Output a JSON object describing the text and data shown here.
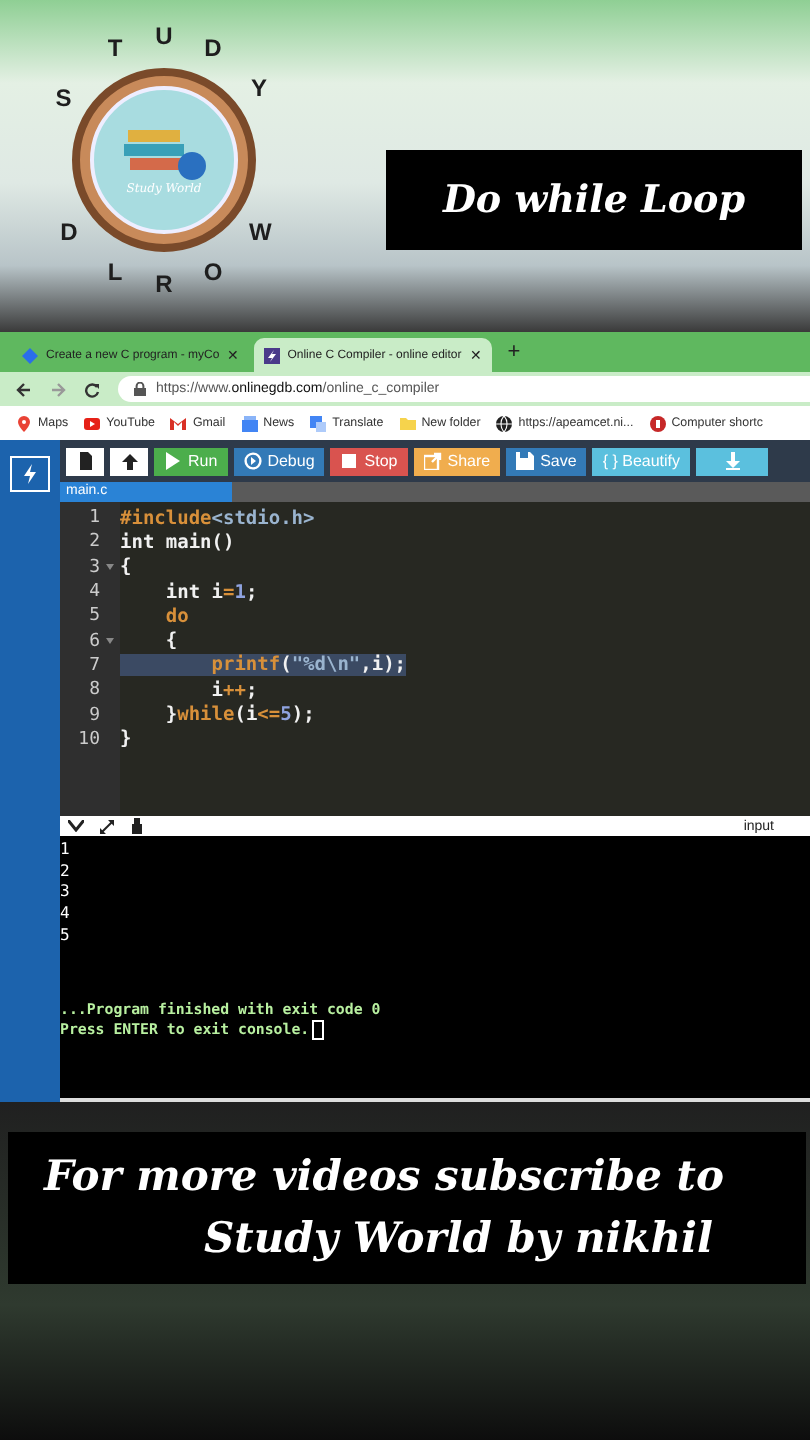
{
  "logo": {
    "ring_letters": [
      "S",
      "T",
      "U",
      "D",
      "Y",
      "W",
      "O",
      "R",
      "L",
      "D"
    ],
    "inner_text": "Study World"
  },
  "title_card": {
    "text": "Do while Loop"
  },
  "browser": {
    "tabs": [
      {
        "label": "Create a new C program - myCo",
        "close": "✕",
        "selected": false
      },
      {
        "label": "Online C Compiler - online editor",
        "close": "✕",
        "selected": true
      }
    ],
    "new_tab": "+",
    "url_scheme": "https://www.",
    "url_domain": "onlinegdb.com",
    "url_path": "/online_c_compiler",
    "bookmarks": [
      {
        "kind": "maps",
        "label": "Maps"
      },
      {
        "kind": "youtube",
        "label": "YouTube"
      },
      {
        "kind": "gmail",
        "label": "Gmail"
      },
      {
        "kind": "news",
        "label": "News"
      },
      {
        "kind": "translate",
        "label": "Translate"
      },
      {
        "kind": "folder",
        "label": "New folder"
      },
      {
        "kind": "globe",
        "label": "https://apeamcet.ni..."
      },
      {
        "kind": "red",
        "label": "Computer shortc"
      }
    ]
  },
  "toolbar": [
    {
      "kind": "file",
      "color": "#ffffff"
    },
    {
      "kind": "upload",
      "color": "#ffffff"
    },
    {
      "kind": "run",
      "label": "Run",
      "color": "#4cae4c"
    },
    {
      "kind": "debug",
      "label": "Debug",
      "color": "#337ab7"
    },
    {
      "kind": "stop",
      "label": "Stop",
      "color": "#d9534f"
    },
    {
      "kind": "share",
      "label": "Share",
      "color": "#f0ad4e"
    },
    {
      "kind": "save",
      "label": "Save",
      "color": "#337ab7"
    },
    {
      "kind": "beautify",
      "label": "{ } Beautify",
      "color": "#5bc0de"
    },
    {
      "kind": "download",
      "color": "#5bc0de"
    }
  ],
  "file_tab": "main.c",
  "code": [
    {
      "number": "1",
      "foldable": false,
      "highlighted": false,
      "tokens": [
        {
          "kind": "pre",
          "text": "#include"
        },
        {
          "kind": "str",
          "text": "<stdio.h>"
        }
      ]
    },
    {
      "number": "2",
      "foldable": false,
      "highlighted": false,
      "tokens": [
        {
          "kind": "plain",
          "text": "int main()"
        }
      ]
    },
    {
      "number": "3",
      "foldable": true,
      "highlighted": false,
      "tokens": [
        {
          "kind": "plain",
          "text": "{"
        }
      ]
    },
    {
      "number": "4",
      "foldable": false,
      "highlighted": false,
      "tokens": [
        {
          "kind": "plain",
          "text": "    int i"
        },
        {
          "kind": "op",
          "text": "="
        },
        {
          "kind": "num",
          "text": "1"
        },
        {
          "kind": "plain",
          "text": ";"
        }
      ]
    },
    {
      "number": "5",
      "foldable": false,
      "highlighted": false,
      "tokens": [
        {
          "kind": "kw",
          "text": "    do"
        }
      ]
    },
    {
      "number": "6",
      "foldable": true,
      "highlighted": false,
      "tokens": [
        {
          "kind": "plain",
          "text": "    {"
        }
      ]
    },
    {
      "number": "7",
      "foldable": false,
      "highlighted": true,
      "tokens": [
        {
          "kind": "kw",
          "text": "        printf"
        },
        {
          "kind": "plain",
          "text": "("
        },
        {
          "kind": "str",
          "text": "\"%d\\n\""
        },
        {
          "kind": "plain",
          "text": ",i);"
        }
      ]
    },
    {
      "number": "8",
      "foldable": false,
      "highlighted": false,
      "tokens": [
        {
          "kind": "plain",
          "text": "        i"
        },
        {
          "kind": "op",
          "text": "++"
        },
        {
          "kind": "plain",
          "text": ";"
        }
      ]
    },
    {
      "number": "9",
      "foldable": false,
      "highlighted": false,
      "tokens": [
        {
          "kind": "plain",
          "text": "    }"
        },
        {
          "kind": "kw",
          "text": "while"
        },
        {
          "kind": "plain",
          "text": "(i"
        },
        {
          "kind": "op",
          "text": "<="
        },
        {
          "kind": "num",
          "text": "5"
        },
        {
          "kind": "plain",
          "text": ");"
        }
      ]
    },
    {
      "number": "10",
      "foldable": false,
      "highlighted": false,
      "tokens": [
        {
          "kind": "plain",
          "text": "}"
        }
      ]
    }
  ],
  "console": {
    "input_label": "input",
    "output": [
      "1",
      "2",
      "3",
      "4",
      "5"
    ],
    "messages": [
      "...Program finished with exit code 0",
      "Press ENTER to exit console."
    ]
  },
  "footer": {
    "lines": [
      "For more videos subscribe to",
      "Study World by nikhil"
    ]
  }
}
